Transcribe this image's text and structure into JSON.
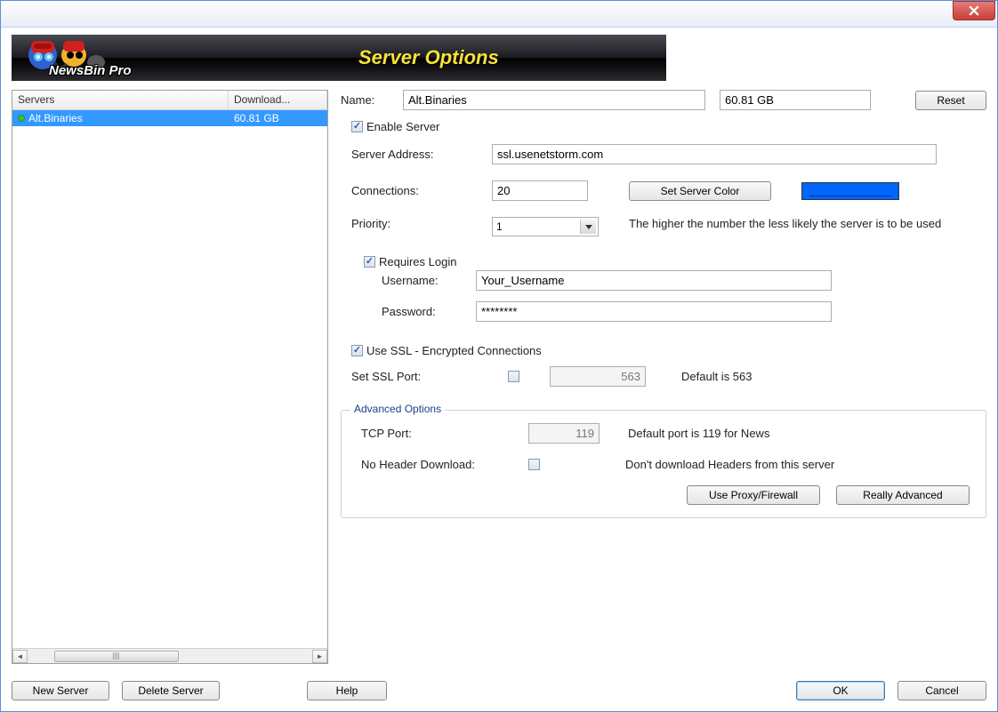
{
  "window": {
    "title": ""
  },
  "banner": {
    "product": "NewsBin Pro",
    "title": "Server Options"
  },
  "server_list": {
    "columns": [
      "Servers",
      "Download..."
    ],
    "rows": [
      {
        "name": "Alt.Binaries",
        "download": "60.81 GB"
      }
    ]
  },
  "fields": {
    "name_label": "Name:",
    "name_value": "Alt.Binaries",
    "download_value": "60.81 GB",
    "reset_label": "Reset",
    "enable_server_label": "Enable Server",
    "server_address_label": "Server Address:",
    "server_address_value": "ssl.usenetstorm.com",
    "connections_label": "Connections:",
    "connections_value": "20",
    "set_color_label": "Set Server Color",
    "priority_label": "Priority:",
    "priority_value": "1",
    "priority_hint": "The higher the number the less likely the server is to be used",
    "requires_login_label": "Requires Login",
    "username_label": "Username:",
    "username_value": "Your_Username",
    "password_label": "Password:",
    "password_value": "********",
    "use_ssl_label": "Use SSL - Encrypted Connections",
    "ssl_port_label": "Set SSL Port:",
    "ssl_port_value": "563",
    "ssl_default_label": "Default is 563",
    "advanced_title": "Advanced Options",
    "tcp_port_label": "TCP Port:",
    "tcp_port_value": "119",
    "tcp_default_label": "Default port is 119 for News",
    "no_header_label": "No Header Download:",
    "no_header_hint": "Don't download Headers from this server",
    "proxy_label": "Use Proxy/Firewall",
    "really_advanced_label": "Really Advanced"
  },
  "buttons": {
    "new_server": "New Server",
    "delete_server": "Delete Server",
    "help": "Help",
    "ok": "OK",
    "cancel": "Cancel"
  },
  "colors": {
    "server_color": "#0066ff"
  }
}
